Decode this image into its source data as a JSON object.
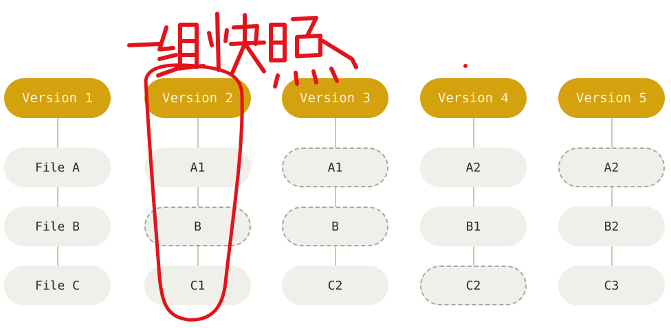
{
  "annotation": {
    "handwritten_text": "一组快照",
    "ink_color": "#e3131b"
  },
  "colors": {
    "version_fill": "#d4a20f",
    "version_text": "#fbf3df",
    "file_fill": "#f0efea",
    "reference_border": "#a8a6a1",
    "connector": "#c9c6c0"
  },
  "row_labels": [
    "File A",
    "File B",
    "File C"
  ],
  "versions": [
    {
      "label": "Version 1",
      "files": [
        {
          "label": "File A",
          "ref": false
        },
        {
          "label": "File B",
          "ref": false
        },
        {
          "label": "File C",
          "ref": false
        }
      ]
    },
    {
      "label": "Version 2",
      "files": [
        {
          "label": "A1",
          "ref": false
        },
        {
          "label": "B",
          "ref": true
        },
        {
          "label": "C1",
          "ref": false
        }
      ]
    },
    {
      "label": "Version 3",
      "files": [
        {
          "label": "A1",
          "ref": true
        },
        {
          "label": "B",
          "ref": true
        },
        {
          "label": "C2",
          "ref": false
        }
      ]
    },
    {
      "label": "Version 4",
      "files": [
        {
          "label": "A2",
          "ref": false
        },
        {
          "label": "B1",
          "ref": false
        },
        {
          "label": "C2",
          "ref": true
        }
      ]
    },
    {
      "label": "Version 5",
      "files": [
        {
          "label": "A2",
          "ref": true
        },
        {
          "label": "B2",
          "ref": false
        },
        {
          "label": "C3",
          "ref": false
        }
      ]
    }
  ]
}
